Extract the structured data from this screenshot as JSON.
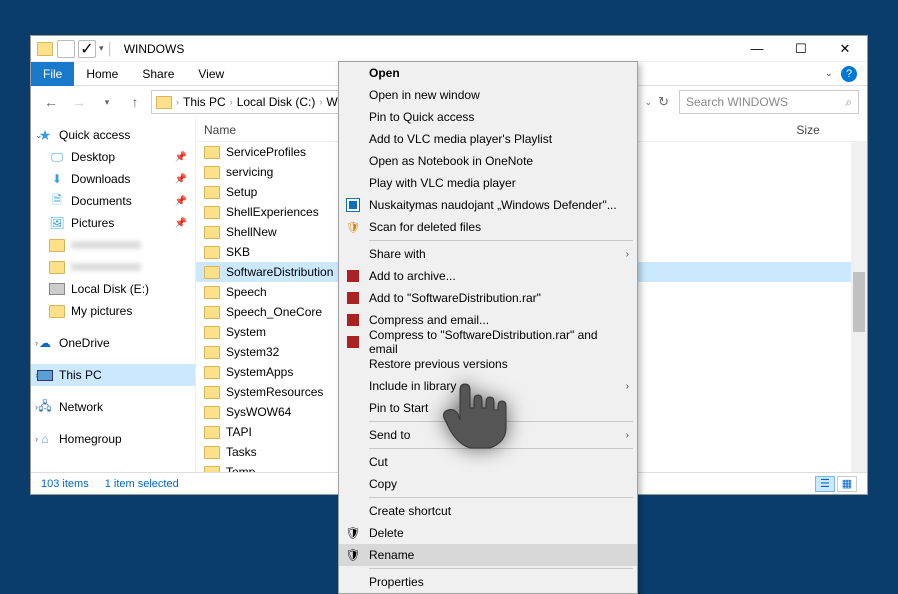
{
  "titlebar": {
    "title": "WINDOWS"
  },
  "ribbon": {
    "file": "File",
    "tabs": [
      "Home",
      "Share",
      "View"
    ]
  },
  "breadcrumbs": [
    "This PC",
    "Local Disk (C:)",
    "WINDO"
  ],
  "search": {
    "placeholder": "Search WINDOWS"
  },
  "nav_pane": {
    "quick_access": {
      "label": "Quick access"
    },
    "quick_items": [
      {
        "label": "Desktop",
        "pinned": true,
        "icon": "desktop"
      },
      {
        "label": "Downloads",
        "pinned": true,
        "icon": "downloads"
      },
      {
        "label": "Documents",
        "pinned": true,
        "icon": "documents"
      },
      {
        "label": "Pictures",
        "pinned": true,
        "icon": "pictures"
      }
    ],
    "drive": {
      "label": "Local Disk (E:)"
    },
    "my_pictures": {
      "label": "My pictures"
    },
    "onedrive": {
      "label": "OneDrive"
    },
    "this_pc": {
      "label": "This PC"
    },
    "network": {
      "label": "Network"
    },
    "homegroup": {
      "label": "Homegroup"
    }
  },
  "columns": {
    "name": "Name",
    "size": "Size"
  },
  "folders": [
    "ServiceProfiles",
    "servicing",
    "Setup",
    "ShellExperiences",
    "ShellNew",
    "SKB",
    "SoftwareDistribution",
    "Speech",
    "Speech_OneCore",
    "System",
    "System32",
    "SystemApps",
    "SystemResources",
    "SysWOW64",
    "TAPI",
    "Tasks",
    "Temp"
  ],
  "selected_folder_index": 6,
  "statusbar": {
    "items": "103 items",
    "selected": "1 item selected"
  },
  "context_menu": {
    "open": "Open",
    "open_new": "Open in new window",
    "pin_quick": "Pin to Quick access",
    "add_vlc": "Add to VLC media player's Playlist",
    "open_onenote": "Open as Notebook in OneNote",
    "play_vlc": "Play with VLC media player",
    "defender": "Nuskaitymas naudojant „Windows Defender\"...",
    "scan_deleted": "Scan for deleted files",
    "share_with": "Share with",
    "add_archive": "Add to archive...",
    "add_rar": "Add to \"SoftwareDistribution.rar\"",
    "compress_email": "Compress and email...",
    "compress_rar_email": "Compress to \"SoftwareDistribution.rar\" and email",
    "restore": "Restore previous versions",
    "include_lib": "Include in library",
    "pin_start": "Pin to Start",
    "send_to": "Send to",
    "cut": "Cut",
    "copy": "Copy",
    "create_shortcut": "Create shortcut",
    "delete": "Delete",
    "rename": "Rename",
    "properties": "Properties"
  }
}
